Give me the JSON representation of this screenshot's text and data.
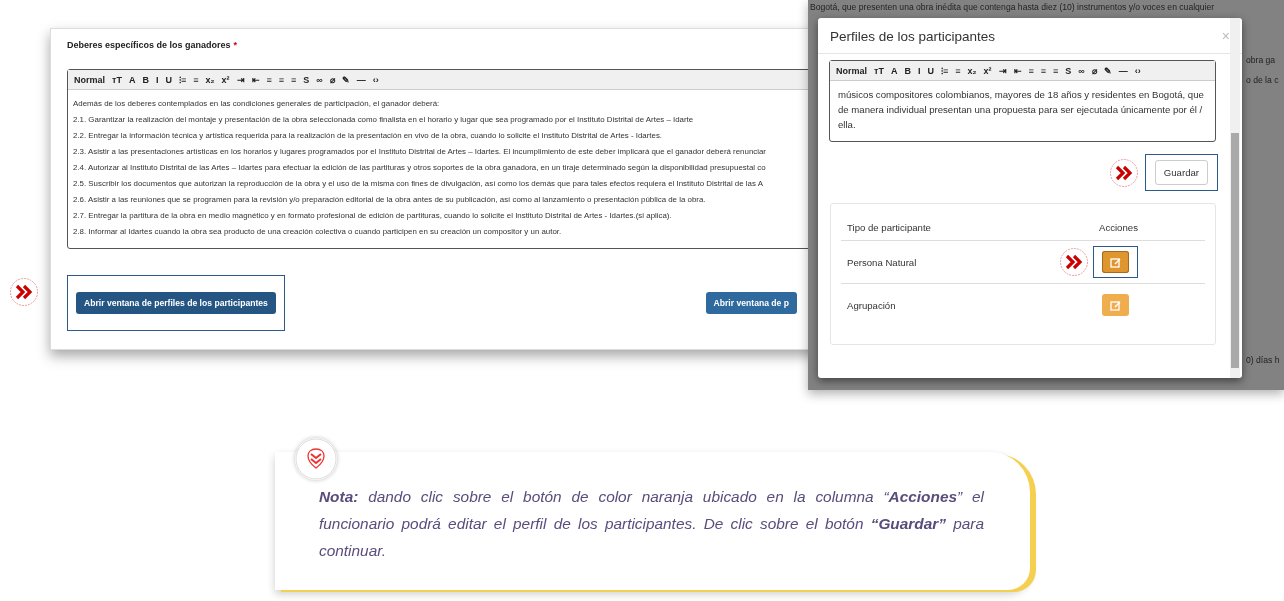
{
  "editor_panel": {
    "label": "Deberes específicos de los ganadores",
    "required_mark": "*",
    "toolbar": {
      "format": "Normal",
      "tools": [
        "ᴛT",
        "A",
        "B",
        "I",
        "U",
        "⁝≡",
        "≡",
        "x₂",
        "x²",
        "⇥",
        "⇤",
        "≡",
        "≡",
        "≡",
        "S",
        "∞",
        "⌀",
        "✎",
        "—",
        "‹›"
      ]
    },
    "lines": [
      "Además de los deberes contemplados en las condiciones generales de participación, el ganador deberá:",
      "2.1. Garantizar la realización del montaje y presentación de la obra seleccionada como finalista en el horario y lugar que sea programado por el Instituto Distrital de Artes – Idarte",
      "2.2. Entregar la información técnica y artística requerida para la realización de la presentación en vivo de la obra, cuando lo solicite el Instituto Distrital de Artes - Idartes.",
      "2.3. Asistir a las presentaciones artísticas en los horarios y lugares programados por el Instituto Distrital de Artes – Idartes. El incumplimiento de este deber implicará que el ganador deberá renunciar",
      "2.4. Autorizar al Instituto Distrital de las Artes – Idartes para efectuar la edición de las partituras y otros soportes de la obra ganadora, en un tiraje determinado según la disponibilidad presupuestal co",
      "2.5. Suscribir los documentos que autorizan la reproducción de la obra y el uso de la misma con fines de divulgación, así como los demás que para tales efectos requiera el Instituto Distrital de las A",
      "2.6. Asistir a las reuniones que se programen para la revisión y/o preparación editorial de la obra antes de su publicación, así como al lanzamiento o presentación pública de la obra.",
      "2.7. Entregar la partitura de la obra en medio magnético y en formato profesional de edición de partituras, cuando lo solicite el Instituto Distrital de Artes - Idartes.(si aplica).",
      "2.8. Informar al Idartes cuando la obra sea producto de una creación colectiva o cuando participen en su creación un compositor y un autor."
    ],
    "buttons": [
      {
        "label": "Abrir ventana de perfiles de los participantes",
        "highlighted": true
      },
      {
        "label": "Abrir ventana de p",
        "highlighted": false
      }
    ]
  },
  "modal_screen": {
    "background_texts": [
      "Bogotá, que presenten una obra inédita que contenga hasta diez (10) instrumentos y/o voces en cualquier",
      "obra ga",
      "o de la c",
      "0) días h"
    ],
    "modal": {
      "title": "Perfiles de los participantes",
      "close": "×",
      "toolbar": {
        "format": "Normal",
        "tools": [
          "ᴛT",
          "A",
          "B",
          "I",
          "U",
          "⁝≡",
          "≡",
          "x₂",
          "x²",
          "⇥",
          "⇤",
          "≡",
          "≡",
          "≡",
          "S",
          "∞",
          "⌀",
          "✎",
          "—",
          "‹›"
        ]
      },
      "text": "músicos compositores colombianos, mayores de 18 años y residentes en Bogotá, que de manera individual presentan una propuesta para ser ejecutada únicamente por él / ella.",
      "save_button": {
        "label": "Guardar",
        "highlighted": true
      },
      "table": {
        "columns": [
          "Tipo de participante",
          "Acciones"
        ],
        "rows": [
          {
            "type": "Persona Natural",
            "highlighted": true
          },
          {
            "type": "Agrupación",
            "highlighted": false
          }
        ]
      }
    }
  },
  "note": "**Nota:** dando clic sobre el botón de color naranja ubicado en la columna “**Acciones**” el funcionario podrá editar el perfil de los participantes. De clic sobre el botón **“Guardar”** para continuar."
}
